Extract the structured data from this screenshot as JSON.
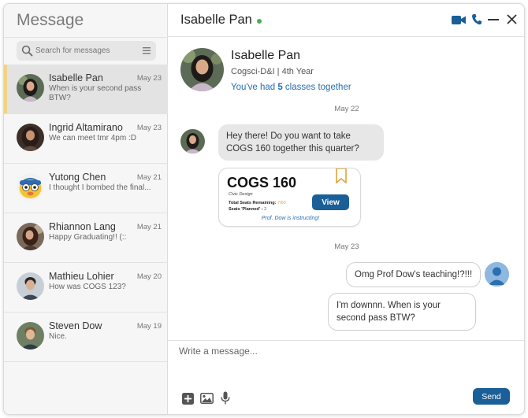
{
  "sidebar": {
    "title": "Message",
    "search": {
      "placeholder": "Search for messages",
      "value": ""
    },
    "conversations": [
      {
        "name": "Isabelle Pan",
        "date": "May 23",
        "preview": "When is your second pass BTW?",
        "active": true
      },
      {
        "name": "Ingrid Altamirano",
        "date": "May 23",
        "preview": "We can meet tmr 4pm :D",
        "active": false
      },
      {
        "name": "Yutong Chen",
        "date": "May 21",
        "preview": "I thought I bombed the final...",
        "active": false
      },
      {
        "name": "Rhiannon Lang",
        "date": "May 21",
        "preview": "Happy Graduating!! (::",
        "active": false
      },
      {
        "name": "Mathieu Lohier",
        "date": "May 20",
        "preview": "How was COGS 123?",
        "active": false
      },
      {
        "name": "Steven Dow",
        "date": "May 19",
        "preview": "Nice.",
        "active": false
      }
    ]
  },
  "header": {
    "name": "Isabelle Pan",
    "status": "online",
    "icons": [
      "video-icon",
      "phone-icon",
      "minimize-icon",
      "close-icon"
    ]
  },
  "profile": {
    "name": "Isabelle Pan",
    "subtitle": "Cogsci-D&I | 4th Year",
    "shared_prefix": "You've had ",
    "shared_count": "5",
    "shared_suffix": " classes together"
  },
  "thread": {
    "date_1": "May 22",
    "msg_1": "Hey there! Do you want to take COGS 160 together this quarter?",
    "course_card": {
      "code": "COGS 160",
      "subtitle": "Civic Design",
      "seats_label": "Total Seats Remaining: ",
      "seats_value": "7/60",
      "planned_label": "Seats 'Planned' : ",
      "planned_value": "2",
      "note": "Prof. Dow is instructing!",
      "view_label": "View"
    },
    "date_2": "May 23",
    "msg_2": "Omg Prof Dow's teaching!?!!!",
    "msg_3": "I'm downnn. When is your second pass BTW?"
  },
  "composer": {
    "placeholder": "Write a message...",
    "send_label": "Send"
  },
  "colors": {
    "accent": "#1b5f98",
    "link": "#2a6fb0",
    "active_bar": "#f1d384",
    "online": "#4caf50",
    "bookmark": "#e0a33a"
  }
}
